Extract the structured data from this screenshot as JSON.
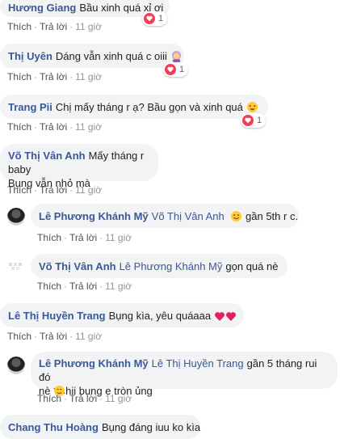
{
  "actions": {
    "like": "Thích",
    "reply": "Trả lời",
    "separator": "·"
  },
  "comments": [
    {
      "author": "Hương Giang",
      "text": "Bầu xinh quá xỉ ơi",
      "time": "11 giờ",
      "reactions": "1"
    },
    {
      "author": "Thị Uyên",
      "text": "Dáng vẫn xinh quá c oiii",
      "time": "11 giờ",
      "reactions": "1"
    },
    {
      "author": "Trang Pii",
      "text": "Chị mấy tháng r ạ? Bầu gọn và xinh quá",
      "time": "11 giờ",
      "reactions": "1"
    },
    {
      "author": "Võ Thị Vân Anh",
      "text_line1": "Mấy tháng r baby",
      "text_line2": "Bụng vẫn nhỏ mà",
      "time": "11 giờ"
    },
    {
      "author": "Lê Phương Khánh Mỹ",
      "tag": "Võ Thị Vân Anh",
      "text": "gần 5th r c.",
      "time": "11 giờ"
    },
    {
      "author": "Võ Thị Vân Anh",
      "tag": "Lê Phương Khánh Mỹ",
      "text": "gọn quá nè",
      "time": "11 giờ"
    },
    {
      "author": "Lê Thị Huyền Trang",
      "text": "Bụng kìa, yêu quáaaa",
      "time": "11 giờ"
    },
    {
      "author": "Lê Phương Khánh Mỹ",
      "tag": "Lê Thị Huyền Trang",
      "text_line1": "gần 5 tháng rui đó",
      "text_line2_pre": "nè",
      "text_line2": "hii bụng e tròn ủng",
      "time": "11 giờ"
    },
    {
      "author": "Chang Thu Hoàng",
      "text": "Bụng đáng iuu ko kìa"
    }
  ]
}
